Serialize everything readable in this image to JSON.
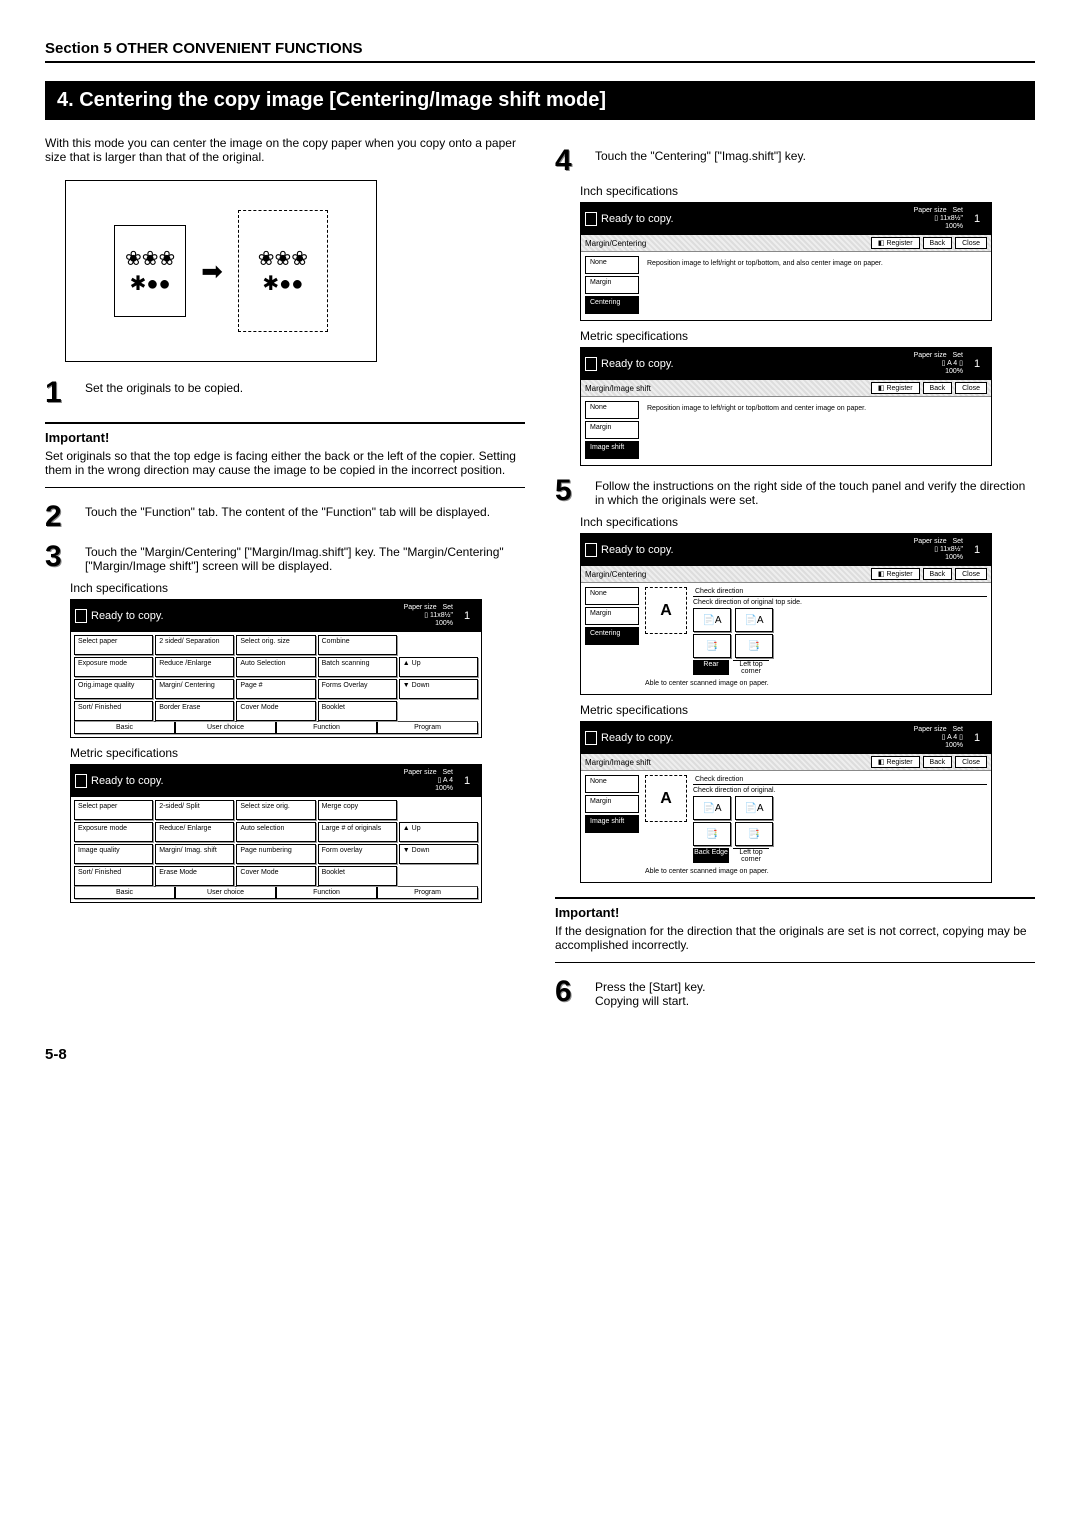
{
  "section_header": "Section 5  OTHER CONVENIENT FUNCTIONS",
  "title": "4.   Centering the copy image [Centering/Image shift mode]",
  "intro": "With this mode you can center the image on the copy paper when you copy onto a paper size that is larger than that of the original.",
  "steps": {
    "s1": "Set the originals to be copied.",
    "s2": "Touch the \"Function\" tab. The content of the \"Function\" tab will be displayed.",
    "s3": "Touch the \"Margin/Centering\" [\"Margin/Imag.shift\"] key. The \"Margin/Centering\" [\"Margin/Image shift\"] screen will be displayed.",
    "s4": "Touch the \"Centering\" [\"Imag.shift\"] key.",
    "s5": "Follow the instructions on the right side of the touch panel and verify the direction in which the originals were set.",
    "s6_a": "Press the [Start] key.",
    "s6_b": "Copying will start."
  },
  "important1": {
    "label": "Important!",
    "text": "Set originals so that the top edge is facing either the back or the left of the copier. Setting them in the wrong direction may cause the image to be copied in the incorrect position."
  },
  "important2": {
    "label": "Important!",
    "text": "If the designation for the direction that the originals are set is not correct, copying may be accomplished incorrectly."
  },
  "labels": {
    "inch": "Inch specifications",
    "metric": "Metric specifications"
  },
  "lcd_common": {
    "ready": "Ready to copy.",
    "paper_size": "Paper size",
    "set": "Set",
    "count": "1",
    "size_inch": "11x8½\"",
    "size_metric": "A 4",
    "zoom": "100%",
    "register": "Register",
    "back": "Back",
    "close": "Close"
  },
  "panel3_inch": {
    "strip": "",
    "grid": [
      [
        "Select paper",
        "2 sided/ Separation",
        "Select orig. size",
        "Combine",
        ""
      ],
      [
        "Exposure mode",
        "Reduce /Enlarge",
        "Auto Selection",
        "Batch scanning",
        "▲ Up"
      ],
      [
        "Orig.image quality",
        "Margin/ Centering",
        "Page #",
        "Forms Overlay",
        "▼ Down"
      ],
      [
        "Sort/ Finished",
        "Border Erase",
        "Cover Mode",
        "Booklet",
        ""
      ]
    ],
    "tabs": [
      "Basic",
      "User choice",
      "Function",
      "Program"
    ]
  },
  "panel3_metric": {
    "grid": [
      [
        "Select paper",
        "2-sided/ Split",
        "Select size orig.",
        "Merge copy",
        ""
      ],
      [
        "Exposure mode",
        "Reduce/ Enlarge",
        "Auto selection",
        "Large # of originals",
        "▲ Up"
      ],
      [
        "Image quality",
        "Margin/ Imag. shift",
        "Page numbering",
        "Form overlay",
        "▼ Down"
      ],
      [
        "Sort/ Finished",
        "Erase Mode",
        "Cover Mode",
        "Booklet",
        ""
      ]
    ],
    "tabs": [
      "Basic",
      "User choice",
      "Function",
      "Program"
    ]
  },
  "panel4_inch": {
    "strip": "Margin/Centering",
    "options": [
      "None",
      "Margin",
      "Centering"
    ],
    "desc": "Reposition image to left/right or top/bottom, and also center image on paper."
  },
  "panel4_metric": {
    "strip": "Margin/Image shift",
    "options": [
      "None",
      "Margin",
      "Image shift"
    ],
    "desc": "Reposition image to left/right or top/bottom and center image on paper."
  },
  "panel5_inch": {
    "strip": "Margin/Centering",
    "options": [
      "None",
      "Margin",
      "Centering"
    ],
    "hint": "Able to center scanned image on paper.",
    "dir_title": "Check direction",
    "dir_sub": "Check direction of original top side.",
    "dir_a": "Rear",
    "dir_b": "Left top corner"
  },
  "panel5_metric": {
    "strip": "Margin/Image shift",
    "options": [
      "None",
      "Margin",
      "Image shift"
    ],
    "hint": "Able to center scanned image on paper.",
    "dir_title": "Check direction",
    "dir_sub": "Check direction of original.",
    "dir_a": "Back Edge",
    "dir_b": "Left top corner"
  },
  "page_num": "5-8"
}
